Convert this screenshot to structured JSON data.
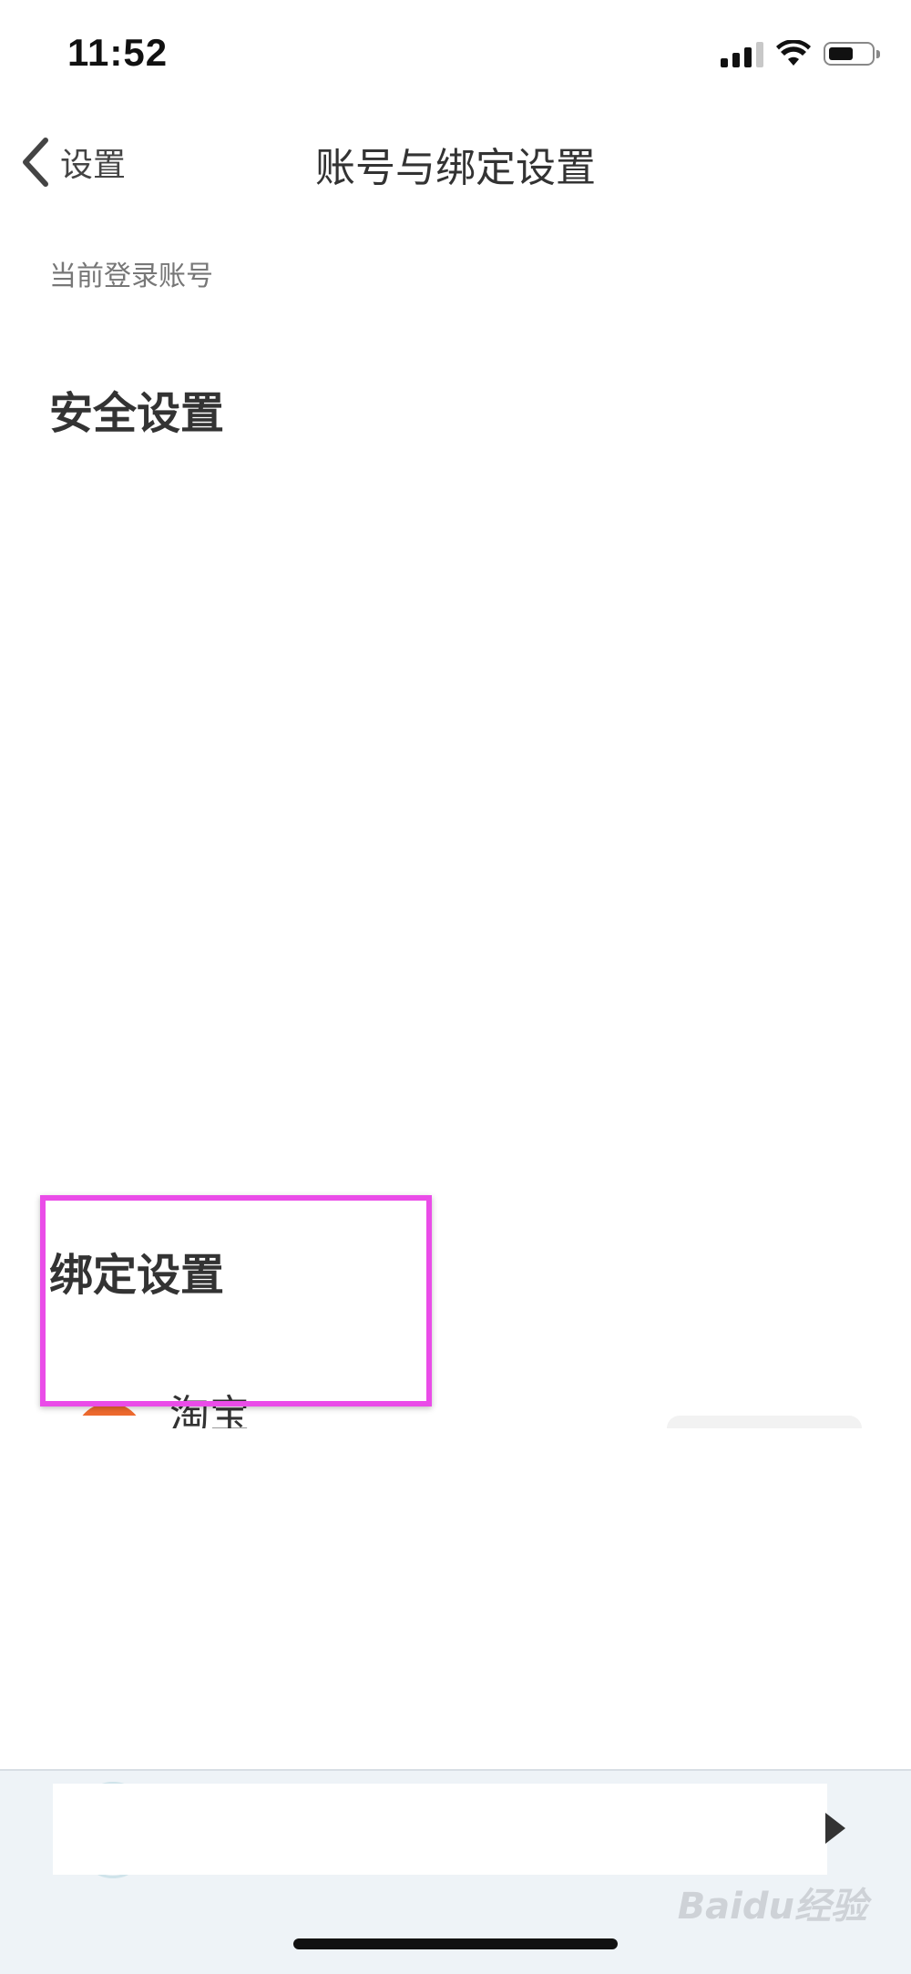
{
  "status_bar": {
    "time": "11:52"
  },
  "nav": {
    "back_label": "设置",
    "title": "账号与绑定设置"
  },
  "account": {
    "current_login_label": "当前登录账号"
  },
  "security": {
    "title": "安全设置"
  },
  "binding": {
    "title": "绑定设置",
    "items": [
      {
        "name": "淘宝",
        "icon": "taobao-icon"
      }
    ]
  },
  "highlight": {
    "color": "#ea4ce8"
  },
  "watermark": {
    "text": "Baidu经验"
  }
}
